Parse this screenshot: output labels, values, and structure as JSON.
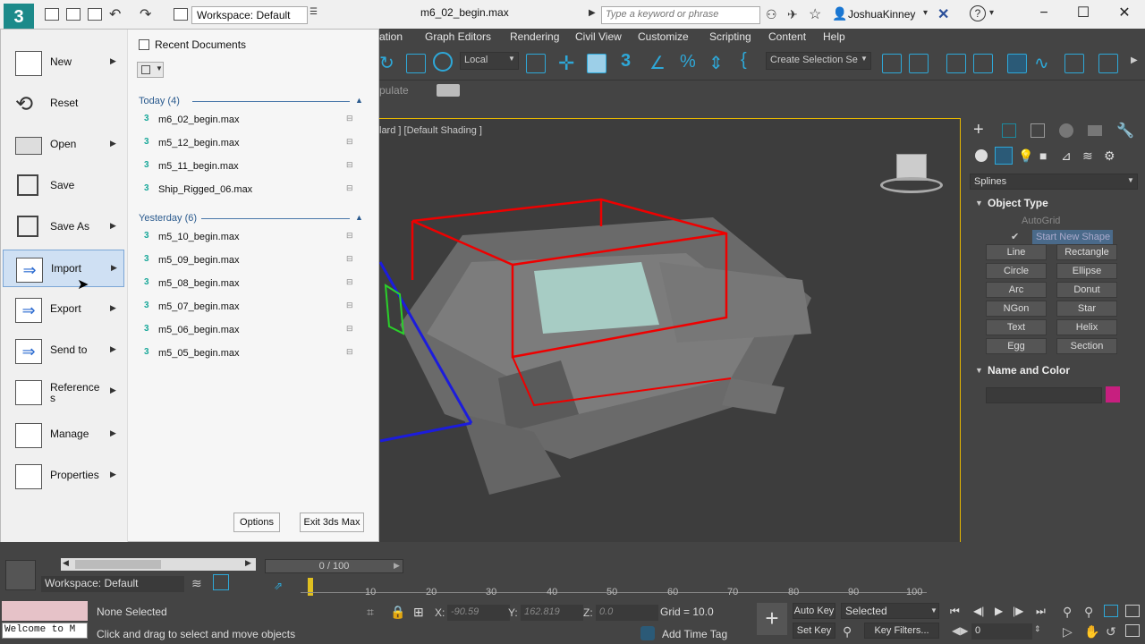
{
  "titlebar": {
    "workspace": "Workspace: Default",
    "doc_title": "m6_02_begin.max",
    "search_placeholder": "Type a keyword or phrase",
    "username": "JoshuaKinney"
  },
  "menubar": [
    "ation",
    "Graph Editors",
    "Rendering",
    "Civil View",
    "Customize",
    "Scripting",
    "Content",
    "Help"
  ],
  "toolbar": {
    "coord_system": "Local",
    "selection_set": "Create Selection Se",
    "populate": "pulate"
  },
  "viewport": {
    "label": "lard ] [Default Shading ]"
  },
  "app_menu": {
    "items": [
      {
        "label": "New",
        "icon": "new-file-icon",
        "submenu": true
      },
      {
        "label": "Reset",
        "icon": "reset-icon",
        "submenu": false
      },
      {
        "label": "Open",
        "icon": "open-folder-icon",
        "submenu": true
      },
      {
        "label": "Save",
        "icon": "save-disk-icon",
        "submenu": false
      },
      {
        "label": "Save As",
        "icon": "save-as-icon",
        "submenu": true
      },
      {
        "label": "Import",
        "icon": "import-icon",
        "submenu": true,
        "active": true
      },
      {
        "label": "Export",
        "icon": "export-icon",
        "submenu": true
      },
      {
        "label": "Send to",
        "icon": "send-to-icon",
        "submenu": true
      },
      {
        "label": "Reference\ns",
        "icon": "references-icon",
        "submenu": true
      },
      {
        "label": "Manage",
        "icon": "manage-icon",
        "submenu": true
      },
      {
        "label": "Properties",
        "icon": "properties-icon",
        "submenu": true
      }
    ],
    "recent_title": "Recent Documents",
    "groups": [
      {
        "label": "Today (4)",
        "files": [
          "m6_02_begin.max",
          "m5_12_begin.max",
          "m5_11_begin.max",
          "Ship_Rigged_06.max"
        ]
      },
      {
        "label": "Yesterday (6)",
        "files": [
          "m5_10_begin.max",
          "m5_09_begin.max",
          "m5_08_begin.max",
          "m5_07_begin.max",
          "m5_06_begin.max",
          "m5_05_begin.max"
        ]
      }
    ],
    "options_label": "Options",
    "exit_label": "Exit 3ds Max"
  },
  "command_panel": {
    "category": "Splines",
    "object_type_title": "Object Type",
    "autogrid": "AutoGrid",
    "start_new_shape": "Start New Shape",
    "shapes": [
      "Line",
      "Rectangle",
      "Circle",
      "Ellipse",
      "Arc",
      "Donut",
      "NGon",
      "Star",
      "Text",
      "Helix",
      "Egg",
      "Section"
    ],
    "name_color_title": "Name and Color",
    "color": "#c71f7f"
  },
  "timeline": {
    "slider": "0 / 100",
    "ticks": [
      "10",
      "20",
      "30",
      "40",
      "50",
      "60",
      "70",
      "80",
      "90",
      "100"
    ]
  },
  "status": {
    "workspace": "Workspace: Default",
    "maxscript": "Welcome to M",
    "selection": "None Selected",
    "prompt": "Click and drag to select and move objects",
    "x_label": "X:",
    "x_value": "-90.59",
    "y_label": "Y:",
    "y_value": "162.819",
    "z_label": "Z:",
    "z_value": "0.0",
    "grid": "Grid = 10.0",
    "add_time_tag": "Add Time Tag",
    "auto_key": "Auto Key",
    "set_key": "Set Key",
    "selected": "Selected",
    "key_filters": "Key Filters...",
    "frame": "0"
  }
}
